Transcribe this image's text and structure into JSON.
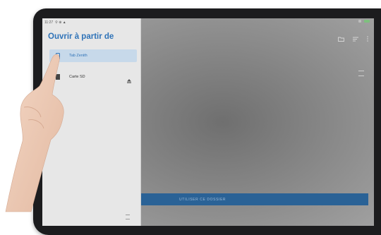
{
  "status_bar": {
    "time": "11:27",
    "indicators": "⚲ ⊕ ▲",
    "icons": [
      "notification-icon",
      "wifi-icon",
      "battery-icon"
    ]
  },
  "drawer": {
    "title": "Ouvrir à partir de",
    "items": [
      {
        "label": "Tab Zenith",
        "icon": "tablet-icon",
        "selected": true
      },
      {
        "label": "Carte SD",
        "icon": "sd-card-icon",
        "selected": false,
        "trailing_icon": "eject-icon"
      }
    ]
  },
  "content": {
    "toolbar_icons": [
      "new-folder-icon",
      "sort-icon",
      "more-icon"
    ],
    "view_toggle_icon": "list-view-icon",
    "primary_button": "UTILISER CE DOSSIER"
  },
  "colors": {
    "accent": "#2f73b8",
    "selected_bg": "#c7d9ea",
    "button_bg": "#2a6296"
  }
}
